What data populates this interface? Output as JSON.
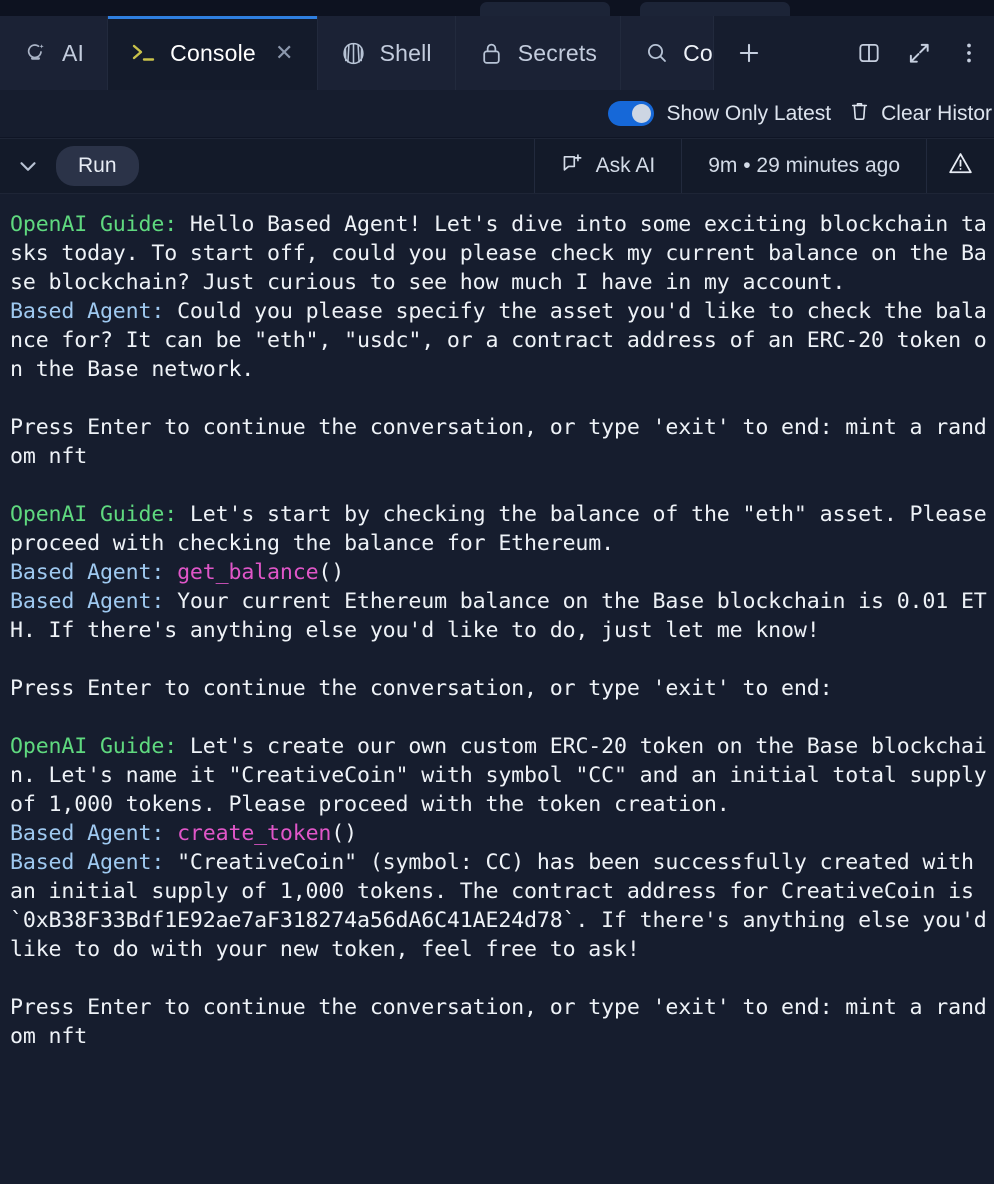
{
  "window": {
    "background": "#161d2e",
    "accent": "#2f7fe0"
  },
  "tabbar": {
    "tabs": [
      {
        "label": "AI",
        "icon": "ai-sparkle-icon",
        "active": false,
        "closable": false
      },
      {
        "label": "Console",
        "icon": "terminal-prompt-icon",
        "active": true,
        "closable": true
      },
      {
        "label": "Shell",
        "icon": "shell-icon",
        "active": false,
        "closable": false
      },
      {
        "label": "Secrets",
        "icon": "lock-icon",
        "active": false,
        "closable": false
      },
      {
        "label": "Co",
        "icon": "search-icon",
        "active": false,
        "closable": false
      }
    ],
    "actions": [
      {
        "name": "new-tab-button",
        "icon": "plus-icon"
      },
      {
        "name": "split-pane-button",
        "icon": "split-pane-icon"
      },
      {
        "name": "expand-button",
        "icon": "expand-diagonal-icon"
      },
      {
        "name": "more-options-button",
        "icon": "kebab-menu-icon"
      }
    ]
  },
  "toolbar": {
    "show_only_latest_label": "Show Only Latest",
    "show_only_latest_on": true,
    "clear_history_label": "Clear Histor",
    "trash_icon": "trash-icon"
  },
  "runbar": {
    "collapse_icon": "chevron-down-icon",
    "run_label": "Run",
    "ask_ai_label": "Ask AI",
    "ask_ai_icon": "message-plus-icon",
    "timing": "9m • 29 minutes ago",
    "warning_icon": "warning-triangle-icon"
  },
  "console": {
    "lines": [
      {
        "segments": [
          {
            "style": "openai",
            "text": "OpenAI Guide: "
          },
          {
            "style": "plain",
            "text": "Hello Based Agent! Let's dive into some exciting blockchain tasks today. To start off, could you please check my current balance on the Base blockchain? Just curious to see how much I have in my account."
          }
        ]
      },
      {
        "segments": [
          {
            "style": "agent",
            "text": "Based Agent: "
          },
          {
            "style": "plain",
            "text": "Could you please specify the asset you'd like to check the balance for? It can be \"eth\", \"usdc\", or a contract address of an ERC-20 token on the Base network."
          }
        ]
      },
      {
        "segments": [
          {
            "style": "plain",
            "text": ""
          }
        ]
      },
      {
        "segments": [
          {
            "style": "plain",
            "text": "Press Enter to continue the conversation, or type 'exit' to end: mint a random nft"
          }
        ]
      },
      {
        "segments": [
          {
            "style": "plain",
            "text": ""
          }
        ]
      },
      {
        "segments": [
          {
            "style": "openai",
            "text": "OpenAI Guide: "
          },
          {
            "style": "plain",
            "text": "Let's start by checking the balance of the \"eth\" asset. Please proceed with checking the balance for Ethereum."
          }
        ]
      },
      {
        "segments": [
          {
            "style": "agent",
            "text": "Based Agent: "
          },
          {
            "style": "fn",
            "text": "get_balance"
          },
          {
            "style": "plain",
            "text": "()"
          }
        ]
      },
      {
        "segments": [
          {
            "style": "agent",
            "text": "Based Agent: "
          },
          {
            "style": "plain",
            "text": "Your current Ethereum balance on the Base blockchain is 0.01 ETH. If there's anything else you'd like to do, just let me know!"
          }
        ]
      },
      {
        "segments": [
          {
            "style": "plain",
            "text": ""
          }
        ]
      },
      {
        "segments": [
          {
            "style": "plain",
            "text": "Press Enter to continue the conversation, or type 'exit' to end:"
          }
        ]
      },
      {
        "segments": [
          {
            "style": "plain",
            "text": ""
          }
        ]
      },
      {
        "segments": [
          {
            "style": "openai",
            "text": "OpenAI Guide: "
          },
          {
            "style": "plain",
            "text": "Let's create our own custom ERC-20 token on the Base blockchain. Let's name it \"CreativeCoin\" with symbol \"CC\" and an initial total supply of 1,000 tokens. Please proceed with the token creation."
          }
        ]
      },
      {
        "segments": [
          {
            "style": "agent",
            "text": "Based Agent: "
          },
          {
            "style": "fn",
            "text": "create_token"
          },
          {
            "style": "plain",
            "text": "()"
          }
        ]
      },
      {
        "segments": [
          {
            "style": "agent",
            "text": "Based Agent: "
          },
          {
            "style": "plain",
            "text": "\"CreativeCoin\" (symbol: CC) has been successfully created with an initial supply of 1,000 tokens. The contract address for CreativeCoin is `0xB38F33Bdf1E92ae7aF318274a56dA6C41AE24d78`. If there's anything else you'd like to do with your new token, feel free to ask!"
          }
        ]
      },
      {
        "segments": [
          {
            "style": "plain",
            "text": ""
          }
        ]
      },
      {
        "segments": [
          {
            "style": "plain",
            "text": "Press Enter to continue the conversation, or type 'exit' to end: mint a random nft"
          }
        ]
      }
    ]
  }
}
